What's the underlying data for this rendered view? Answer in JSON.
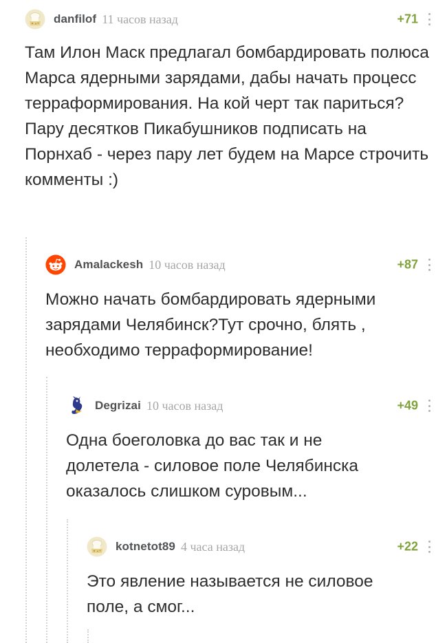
{
  "comments": [
    {
      "username": "danfilof",
      "time": "11 часов назад",
      "rating": "+71",
      "text": "Там Илон Маск предлагал бомбардировать полюса Марса ядерными зарядами, дабы начать процесс терраформирования. На кой черт так париться?\nПару десятков Пикабушников подписать на Порнхаб - через пару лет будем на Марсе строчить комменты :)",
      "avatar_icon": "default-avatar-icon"
    },
    {
      "username": "Amalackesh",
      "time": "10 часов назад",
      "rating": "+87",
      "text": "Можно начать бомбардировать ядерными зарядами Челябинск?Тут срочно, блять , необходимо терраформирование!",
      "avatar_icon": "reddit-alien-icon"
    },
    {
      "username": "Degrizai",
      "time": "10 часов назад",
      "rating": "+49",
      "text": "Одна боеголовка до вас так и не долетела - силовое поле Челябинска оказалось слишком суровым...",
      "avatar_icon": "dragon-icon"
    },
    {
      "username": "kotnetot89",
      "time": "4 часа назад",
      "rating": "+22",
      "text": "Это явление называется не силовое поле, а смог...",
      "avatar_icon": "default-avatar-icon"
    }
  ],
  "colors": {
    "rating": "#7fa23a",
    "username": "#4f5153",
    "time": "#a6a6a6",
    "thread_line": "#d4d4d4"
  }
}
